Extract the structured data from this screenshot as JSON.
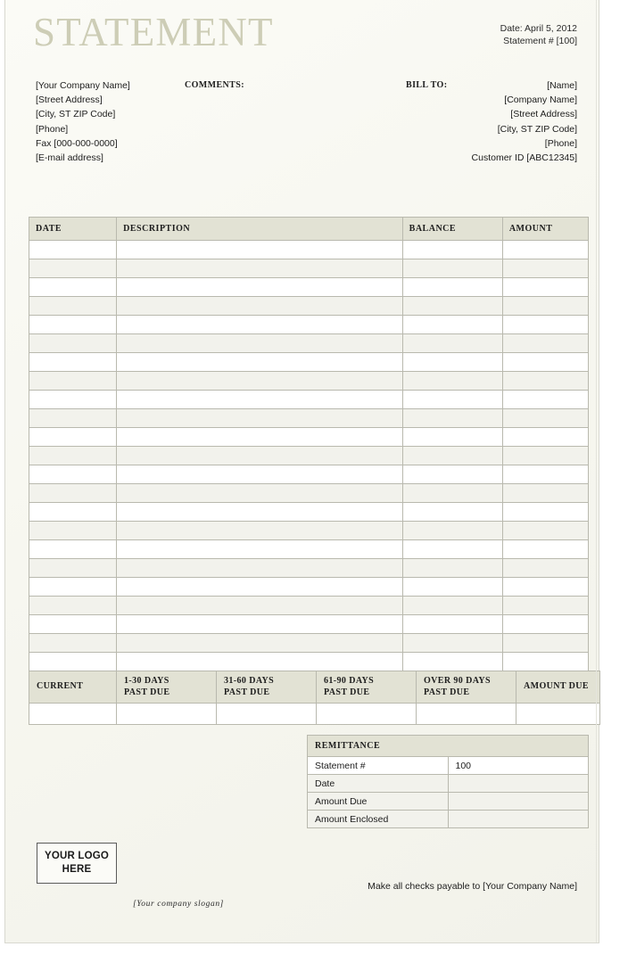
{
  "document": {
    "title": "STATEMENT",
    "title_color": "#cdcdb6",
    "header_band_color": "#e2e2d4",
    "stripe_color": "#f2f2ec",
    "page_background": "#f7f7f0"
  },
  "meta": {
    "date_line": "Date: April 5, 2012",
    "statement_line": "Statement # [100]"
  },
  "from": {
    "lines": [
      "[Your Company Name]",
      "[Street Address]",
      "[City, ST  ZIP Code]",
      "[Phone]",
      "Fax [000-000-0000]",
      "[E-mail address]"
    ]
  },
  "comments": {
    "label": "COMMENTS:",
    "value": ""
  },
  "bill_to": {
    "label": "BILL TO:",
    "lines": [
      "[Name]",
      "[Company Name]",
      "[Street Address]",
      "[City, ST  ZIP Code]",
      "[Phone]",
      "Customer ID [ABC12345]"
    ]
  },
  "ledger": {
    "columns": [
      "DATE",
      "DESCRIPTION",
      "BALANCE",
      "AMOUNT"
    ],
    "row_count": 23,
    "rows": [
      {
        "date": "",
        "description": "",
        "balance": "",
        "amount": ""
      },
      {
        "date": "",
        "description": "",
        "balance": "",
        "amount": ""
      },
      {
        "date": "",
        "description": "",
        "balance": "",
        "amount": ""
      },
      {
        "date": "",
        "description": "",
        "balance": "",
        "amount": ""
      },
      {
        "date": "",
        "description": "",
        "balance": "",
        "amount": ""
      },
      {
        "date": "",
        "description": "",
        "balance": "",
        "amount": ""
      },
      {
        "date": "",
        "description": "",
        "balance": "",
        "amount": ""
      },
      {
        "date": "",
        "description": "",
        "balance": "",
        "amount": ""
      },
      {
        "date": "",
        "description": "",
        "balance": "",
        "amount": ""
      },
      {
        "date": "",
        "description": "",
        "balance": "",
        "amount": ""
      },
      {
        "date": "",
        "description": "",
        "balance": "",
        "amount": ""
      },
      {
        "date": "",
        "description": "",
        "balance": "",
        "amount": ""
      },
      {
        "date": "",
        "description": "",
        "balance": "",
        "amount": ""
      },
      {
        "date": "",
        "description": "",
        "balance": "",
        "amount": ""
      },
      {
        "date": "",
        "description": "",
        "balance": "",
        "amount": ""
      },
      {
        "date": "",
        "description": "",
        "balance": "",
        "amount": ""
      },
      {
        "date": "",
        "description": "",
        "balance": "",
        "amount": ""
      },
      {
        "date": "",
        "description": "",
        "balance": "",
        "amount": ""
      },
      {
        "date": "",
        "description": "",
        "balance": "",
        "amount": ""
      },
      {
        "date": "",
        "description": "",
        "balance": "",
        "amount": ""
      },
      {
        "date": "",
        "description": "",
        "balance": "",
        "amount": ""
      },
      {
        "date": "",
        "description": "",
        "balance": "",
        "amount": ""
      },
      {
        "date": "",
        "description": "",
        "balance": "",
        "amount": ""
      }
    ]
  },
  "aging": {
    "columns": [
      {
        "line1": "CURRENT",
        "line2": ""
      },
      {
        "line1": "1-30 DAYS",
        "line2": "PAST DUE"
      },
      {
        "line1": "31-60 DAYS",
        "line2": "PAST DUE"
      },
      {
        "line1": "61-90 DAYS",
        "line2": "PAST DUE"
      },
      {
        "line1": "OVER 90 DAYS",
        "line2": "PAST DUE"
      },
      {
        "line1": "AMOUNT DUE",
        "line2": ""
      }
    ],
    "values": [
      "",
      "",
      "",
      "",
      "",
      ""
    ]
  },
  "remittance": {
    "heading": "REMITTANCE",
    "rows": [
      {
        "label": "Statement #",
        "value": "100"
      },
      {
        "label": "Date",
        "value": ""
      },
      {
        "label": "Amount Due",
        "value": ""
      },
      {
        "label": "Amount Enclosed",
        "value": ""
      }
    ]
  },
  "footer": {
    "logo_line1": "YOUR LOGO",
    "logo_line2": "HERE",
    "slogan": "[Your company slogan]",
    "payable": "Make all checks payable to [Your Company Name]"
  }
}
